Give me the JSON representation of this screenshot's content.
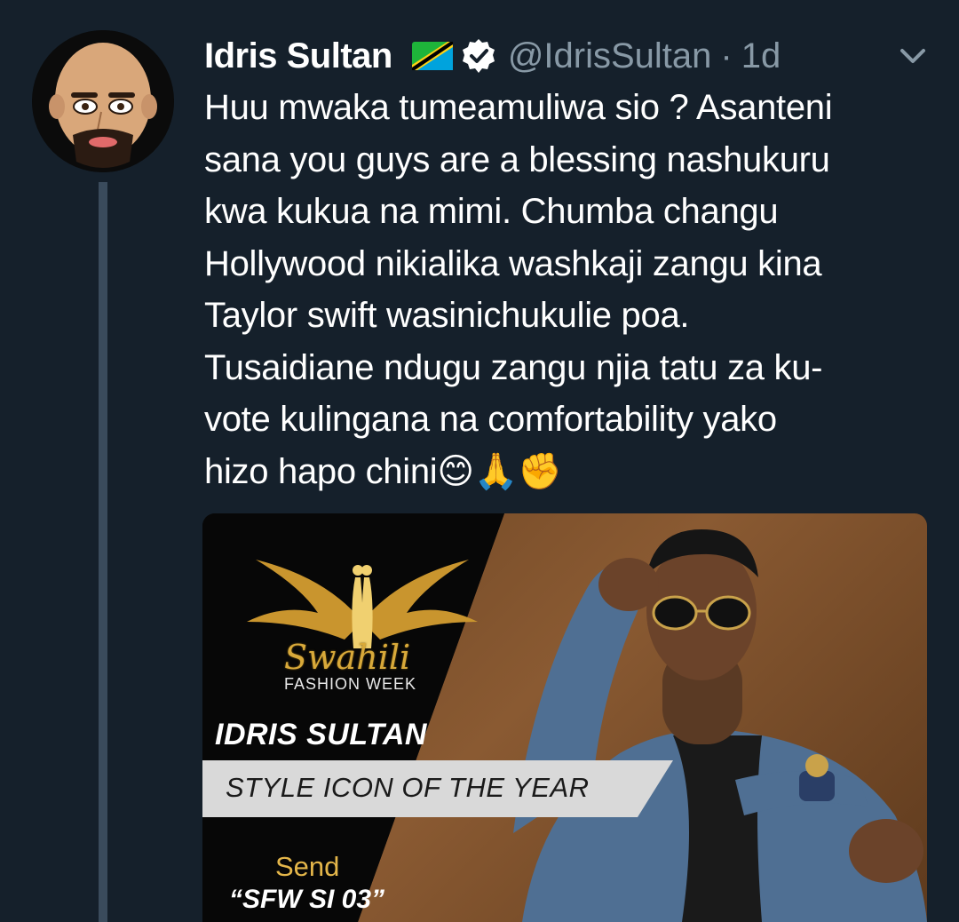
{
  "tweet": {
    "display_name": "Idris Sultan",
    "handle": "@IdrisSultan",
    "separator": "·",
    "time": "1d",
    "text": "Huu mwaka tumeamuliwa sio ? Asanteni\nsana you guys are a blessing nashukuru\nkwa kukua na mimi. Chumba changu\nHollywood nikialika washkaji zangu kina\nTaylor swift wasinichukulie poa.\nTusaidiane ndugu zangu njia tatu za ku-\nvote kulingana na comfortability yako\nhizo hapo chini😊🙏✊"
  },
  "media": {
    "brand_script": "Swahili",
    "brand_week": "FASHION WEEK",
    "name": "IDRIS SULTAN",
    "award": "STYLE ICON OF THE YEAR",
    "send": "Send",
    "code": "“SFW SI 03”"
  },
  "icons": {
    "avatar": "cartoon-avatar",
    "flag": "tanzania-flag-icon",
    "verified": "verified-badge-icon",
    "caret": "chevron-down-icon"
  },
  "colors": {
    "background": "#15202b",
    "secondary_text": "#8899a6",
    "thread_line": "#3a4b5c",
    "verified_badge": "#ffffff",
    "gold": "#d8a93a"
  }
}
